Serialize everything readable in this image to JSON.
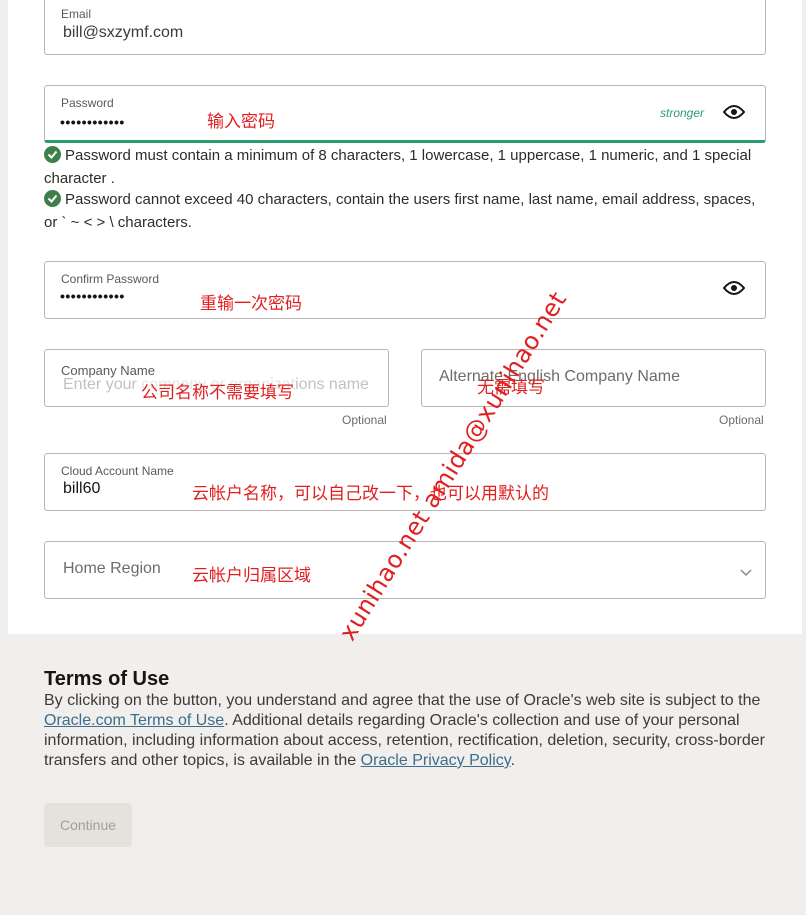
{
  "email": {
    "label": "Email",
    "value": "bill@sxzymf.com"
  },
  "password": {
    "label": "Password",
    "dots": "••••••••••••",
    "strength": "stronger",
    "annotation": "输入密码",
    "toggle_icon": "eye-icon",
    "accent_color": "#2b9c6d"
  },
  "password_rules": [
    {
      "text": "Password must contain a minimum of 8 characters, 1 lowercase, 1 uppercase, 1 numeric, and 1 special character ."
    },
    {
      "text": "Password cannot exceed 40 characters, contain the users first name, last name, email address, spaces, or ` ~ < > \\ characters."
    }
  ],
  "confirm_password": {
    "label": "Confirm Password",
    "dots": "••••••••••••",
    "annotation": "重输一次密码",
    "toggle_icon": "eye-icon"
  },
  "company_name": {
    "label": "Company Name",
    "placeholder": "Enter your company or organizations name",
    "optional": "Optional",
    "annotation": "公司名称不需要填写"
  },
  "alternate_company": {
    "placeholder": "Alternate English Company Name",
    "optional": "Optional",
    "annotation": "无需填写"
  },
  "cloud_account": {
    "label": "Cloud Account Name",
    "value": "bill60",
    "annotation": "云帐户名称，可以自己改一下，也可以用默认的"
  },
  "home_region": {
    "placeholder": "Home Region",
    "annotation": "云帐户归属区域",
    "chevron_icon": "chevron-down-icon"
  },
  "watermark": "xunihao.net  amida@xunihao.net",
  "terms": {
    "title": "Terms of Use",
    "text_1": "By clicking on the button, you understand and agree that the use of Oracle's web site is subject to the ",
    "link_1": "Oracle.com Terms of Use",
    "text_2": ". Additional details regarding Oracle's collection and use of your personal information, including information about access, retention, rectification, deletion, security, cross-border transfers and other topics, is available in the ",
    "link_2": "Oracle Privacy Policy",
    "text_3": "."
  },
  "continue_label": "Continue"
}
